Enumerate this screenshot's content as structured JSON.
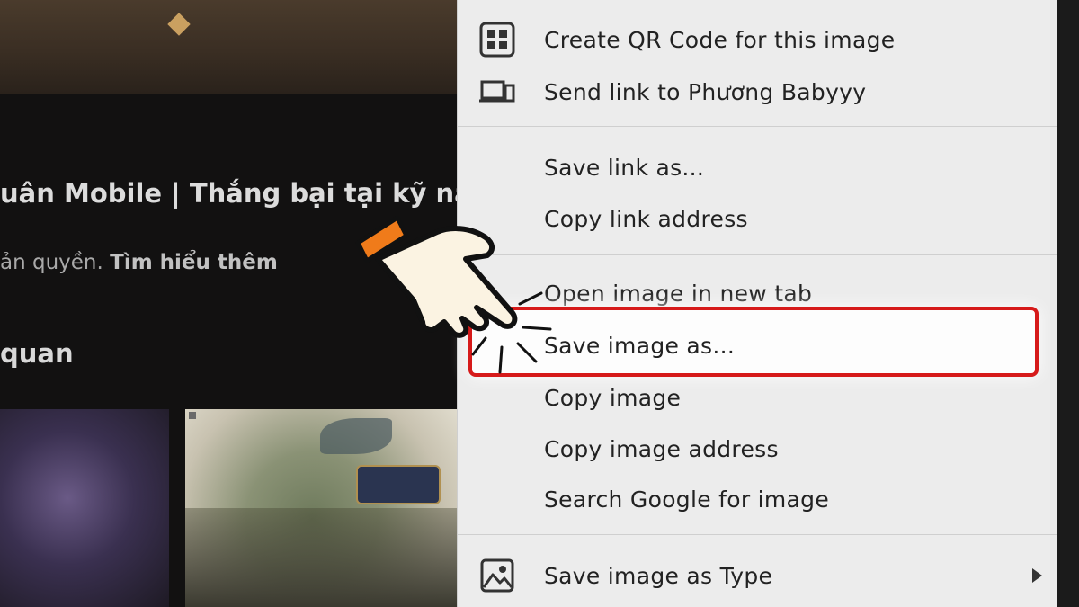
{
  "background_page": {
    "video_title": "uân Mobile | Thắng bại tại kỹ nă",
    "copyright_text": "ản quyền.",
    "learn_more": "Tìm hiểu thêm",
    "related_heading": "quan"
  },
  "context_menu": {
    "items": [
      {
        "label": "Create QR Code for this image",
        "icon": "qr-code-icon"
      },
      {
        "label": "Send link to Phương Babyyy",
        "icon": "devices-icon"
      },
      {
        "label": "Save link as..."
      },
      {
        "label": "Copy link address"
      },
      {
        "label": "Open image in new tab"
      },
      {
        "label": "Save image as...",
        "highlighted": true
      },
      {
        "label": "Copy image"
      },
      {
        "label": "Copy image address"
      },
      {
        "label": "Search Google for image"
      },
      {
        "label": "Save image as Type",
        "icon": "image-icon",
        "submenu": true
      }
    ]
  },
  "colors": {
    "highlight_border": "#d61a1a",
    "menu_bg": "#ececec",
    "cursor_band": "#f07b1a"
  },
  "icons": [
    "qr-code-icon",
    "devices-icon",
    "image-icon",
    "submenu-arrow-icon",
    "pointing-hand-cursor-icon"
  ]
}
